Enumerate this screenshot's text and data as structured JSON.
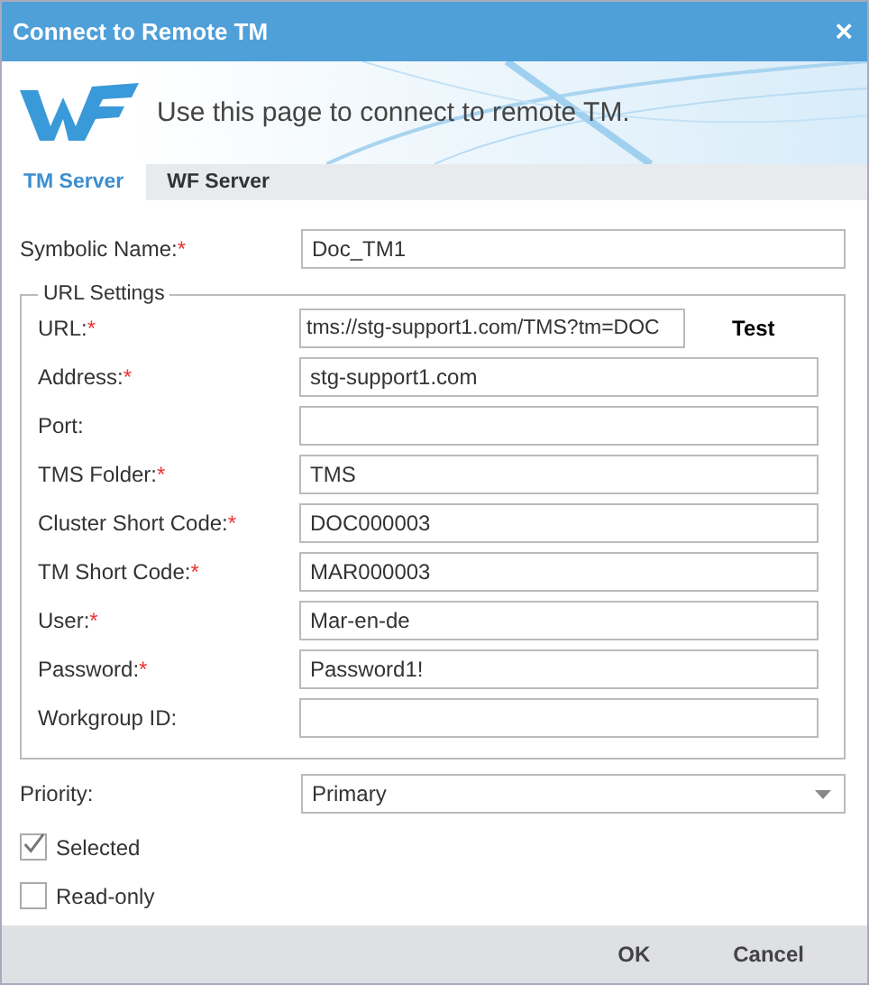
{
  "window": {
    "title": "Connect to Remote TM",
    "close": "×"
  },
  "header": {
    "text": "Use this page to connect to remote TM."
  },
  "tabs": [
    {
      "label": "TM Server",
      "selected": true
    },
    {
      "label": "WF Server",
      "selected": false
    }
  ],
  "symbolic_name": {
    "label": "Symbolic Name:",
    "required_mark": "*",
    "value": "Doc_TM1"
  },
  "url_settings": {
    "legend": "URL Settings",
    "test_button": "Test",
    "fields": [
      {
        "label": "URL:",
        "required_mark": "*",
        "value": "tms://stg-support1.com/TMS?tm=DOC"
      },
      {
        "label": "Address:",
        "required_mark": "*",
        "value": "stg-support1.com"
      },
      {
        "label": "Port:"
      },
      {
        "label": "TMS Folder:",
        "required_mark": "*",
        "value": "TMS"
      },
      {
        "label": "Cluster Short Code:",
        "required_mark": "*",
        "value": "DOC000003"
      },
      {
        "label": "TM Short Code:",
        "required_mark": "*",
        "value": "MAR000003"
      },
      {
        "label": "User:",
        "required_mark": "*",
        "value": "Mar-en-de"
      },
      {
        "label": "Password:",
        "required_mark": "*",
        "value": "Password1!"
      },
      {
        "label": "Workgroup ID:"
      }
    ]
  },
  "priority": {
    "label": "Priority:",
    "value": "Primary"
  },
  "checkboxes": [
    {
      "label": "Selected",
      "checked": true
    },
    {
      "label": "Read-only",
      "checked": false
    }
  ],
  "buttons": [
    "OK",
    "Cancel"
  ]
}
